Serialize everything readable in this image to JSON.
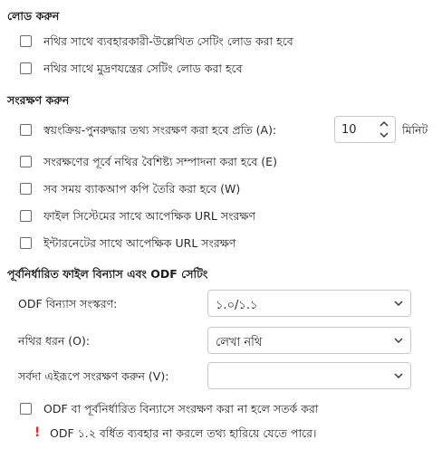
{
  "load": {
    "header": "লোড করুন",
    "items": [
      {
        "label": "নথির সাথে ব্যবহারকারী-উল্লেখিত সেটিং লোড করা হবে",
        "checked": false
      },
      {
        "label": "নথির সাথে মুদ্রণযন্ত্রের সেটিং লোড করা হবে",
        "checked": false
      }
    ]
  },
  "save": {
    "header": "সংরক্ষণ করুন",
    "autorecover_label": "স্বয়ংক্রিয়-পুনরুদ্ধার তথ্য সংরক্ষণ করা হবে প্রতি (A):",
    "autorecover_value": "10",
    "autorecover_unit": "মিনিট",
    "items": [
      {
        "label": "সংরক্ষণের পূর্বে নথির বৈশিষ্ট্য সম্পাদনা করা হবে (E)",
        "checked": false
      },
      {
        "label": "সব সময় ব্যাকআপ কপি তৈরি করা হবে (W)",
        "checked": false
      },
      {
        "label": "ফাইল সিস্টেমের সাথে আপেক্ষিক URL সংরক্ষণ",
        "checked": false
      },
      {
        "label": "ইন্টারনেটের সাথে আপেক্ষিক URL সংরক্ষণ",
        "checked": false
      }
    ]
  },
  "defaults": {
    "header": "পূর্বনির্ধারিত ফাইল বিন্যাস এবং ODF সেটিং",
    "odf_version_label": "ODF বিন্যাস সংস্করণ:",
    "odf_version_value": "১.০/১.১",
    "doc_type_label": "নথির ধরন (O):",
    "doc_type_value": "লেখা নথি",
    "always_save_label": "সর্বদা এইরূপে সংরক্ষণ করুন (V):",
    "always_save_value": "",
    "warn_label": "ODF বা পূর্বনির্ধারিত বিন্যাসে সংরক্ষণ করা না হলে সতর্ক করা",
    "warn_checked": false,
    "warning_icon": "exclamation-icon",
    "warning_text": "ODF ১.২ বর্ধিত ব্যবহার না করলে তথ্য হারিয়ে যেতে পারে।",
    "warning_color": "#d32f2f"
  }
}
